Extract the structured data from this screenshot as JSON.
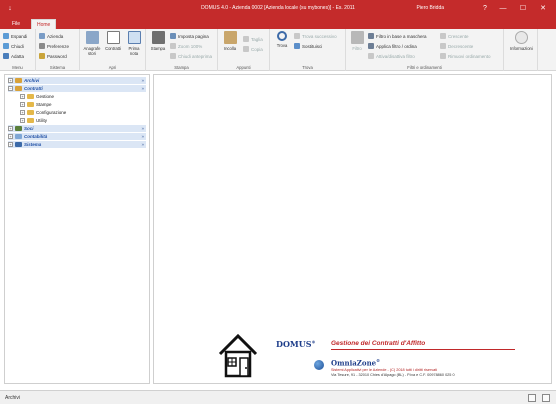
{
  "titlebar": {
    "quick_access": "↓",
    "title": "DOMUS 4.0  -  Azienda 0002 [Azienda locale (su mybones)]  -  Es. 2011",
    "user": "Piero Bridda",
    "help": "?",
    "minimize": "—",
    "maximize": "☐",
    "close": "✕"
  },
  "tabs": {
    "file": "File",
    "home": "Home"
  },
  "ribbon": {
    "menu": {
      "label": "Menu",
      "expand": "Espandi",
      "collapse": "Chiudi",
      "adapt": "Adatta"
    },
    "sistema": {
      "label": "Sistema",
      "azienda": "Azienda",
      "preferenze": "Preferenze",
      "password": "Password"
    },
    "apri": {
      "label": "Apri",
      "anagrafe": "Anagrafe stori",
      "contratti": "Contratti",
      "prima_nota": "Prima nota"
    },
    "stampa": {
      "label": "Stampa",
      "stampa": "Stampa",
      "imposta": "Imposta pagina",
      "zoom": "Zoom 100%",
      "chiudi_anteprima": "Chiudi anteprima"
    },
    "appunti": {
      "label": "Appunti",
      "incolla": "Incolla",
      "taglia": "Taglia",
      "copia": "Copia"
    },
    "trova": {
      "label": "Trova",
      "trova": "Trova",
      "successivo": "Trova successivo",
      "sostituisci": "Sostituisci"
    },
    "filtri": {
      "label": "Filtri e ordinamenti",
      "filtro": "Filtro",
      "base_maschera": "Filtro in base a maschera",
      "applica": "Applica filtro / ordina",
      "attiva": "Attiva/disattiva filtro",
      "crescente": "Crescente",
      "decrescente": "Decrescente",
      "rimuovi": "Rimuovi ordinamento"
    },
    "info": {
      "label": "Informazioni"
    }
  },
  "tree": {
    "archivi": "Archivi",
    "contratti": "Contratti",
    "gestione": "Gestione",
    "stampe": "Stampe",
    "configurazione": "Configurazione",
    "utility": "Utility",
    "soci": "Soci",
    "contabilita": "Contabilità",
    "sistema": "Sistema",
    "chevron": "»",
    "expand": "+",
    "collapse": "−"
  },
  "branding": {
    "domus": "DOMUS",
    "reg": "®",
    "product": "Gestione dei Contratti d'Affitto",
    "company": "OmniaZone",
    "line1": "Sistemi Applicativi per le Aziende  -  (C) 2018 tutti i diritti riservati",
    "line2": "Via Tesure, 91  -  32010 Chies d'Alpago (BL)  -  P.iva e C.F. 00978860 025 0"
  },
  "status": {
    "text": "Archivi"
  },
  "colors": {
    "accent": "#c42b2b",
    "brand_blue": "#1d3d8a",
    "tree_head": "#dbe6f5"
  }
}
